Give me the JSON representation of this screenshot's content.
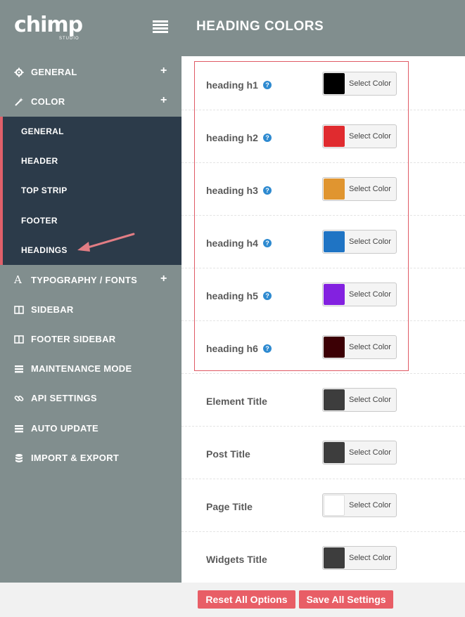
{
  "header": {
    "logo_text": "chimp",
    "logo_sub": "STUDIO",
    "title": "HEADING COLORS"
  },
  "sidebar": {
    "items": [
      {
        "label": "GENERAL",
        "icon": "gear-icon",
        "expandable": true
      },
      {
        "label": "COLOR",
        "icon": "wand-icon",
        "expandable": true
      },
      {
        "label": "TYPOGRAPHY / FONTS",
        "icon": "font-icon",
        "expandable": true
      },
      {
        "label": "SIDEBAR",
        "icon": "columns-icon",
        "expandable": false
      },
      {
        "label": "FOOTER SIDEBAR",
        "icon": "columns-icon",
        "expandable": false
      },
      {
        "label": "MAINTENANCE MODE",
        "icon": "list-icon",
        "expandable": false
      },
      {
        "label": "API SETTINGS",
        "icon": "link-icon",
        "expandable": false
      },
      {
        "label": "AUTO UPDATE",
        "icon": "list-icon",
        "expandable": false
      },
      {
        "label": "IMPORT & EXPORT",
        "icon": "database-icon",
        "expandable": false
      }
    ],
    "color_submenu": [
      "GENERAL",
      "HEADER",
      "TOP STRIP",
      "FOOTER",
      "HEADINGS"
    ],
    "active_submenu": "HEADINGS",
    "plus_glyph": "+"
  },
  "main": {
    "picker_label": "Select Color",
    "help_glyph": "?",
    "rows": [
      {
        "label": "heading h1",
        "color": "#000000",
        "help": true
      },
      {
        "label": "heading h2",
        "color": "#e02b2f",
        "help": true
      },
      {
        "label": "heading h3",
        "color": "#e09530",
        "help": true
      },
      {
        "label": "heading h4",
        "color": "#1f74c4",
        "help": true
      },
      {
        "label": "heading h5",
        "color": "#8321e0",
        "help": true
      },
      {
        "label": "heading h6",
        "color": "#3c0005",
        "help": true
      },
      {
        "label": "Element Title",
        "color": "#3d3d3d",
        "help": false
      },
      {
        "label": "Post Title",
        "color": "#3d3d3d",
        "help": false
      },
      {
        "label": "Page Title",
        "color": "#ffffff",
        "help": false
      },
      {
        "label": "Widgets Title",
        "color": "#3d3d3d",
        "help": false
      }
    ]
  },
  "footer": {
    "reset_label": "Reset All Options",
    "save_label": "Save All Settings"
  },
  "colors": {
    "sidebar_bg": "#818e8e",
    "submenu_bg": "#2c3b4a",
    "accent": "#e85e66",
    "help": "#2e8ad0"
  }
}
